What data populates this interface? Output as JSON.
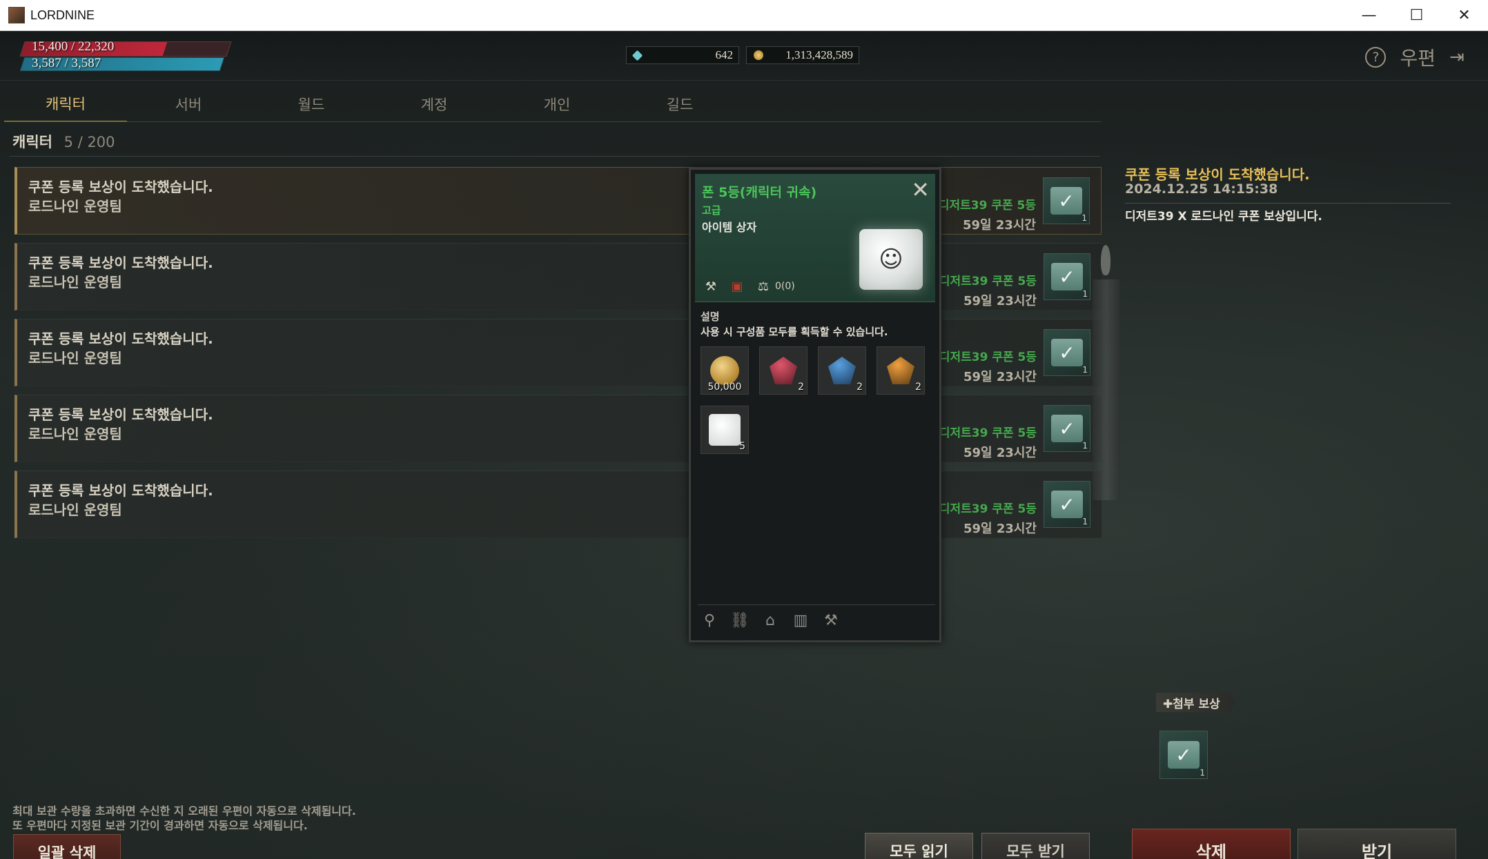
{
  "window": {
    "title": "LORDNINE",
    "minimize": "—",
    "maximize": "☐",
    "close": "✕"
  },
  "status": {
    "hp_text": "15,400 / 22,320",
    "hp_fraction": 0.69,
    "mp_text": "3,587 / 3,587",
    "mp_fraction": 1.0,
    "diamonds": "642",
    "gold": "1,313,428,589"
  },
  "header": {
    "title": "우편",
    "help": "?",
    "exit": "⇥"
  },
  "tabs": [
    {
      "label": "캐릭터",
      "active": true
    },
    {
      "label": "서버"
    },
    {
      "label": "월드"
    },
    {
      "label": "계정"
    },
    {
      "label": "개인"
    },
    {
      "label": "길드"
    }
  ],
  "mailbox": {
    "count_label": "캐릭터",
    "count": "5 / 200",
    "items": [
      {
        "title": "쿠폰 등록 보상이 도착했습니다.",
        "sender": "로드나인 운영팀",
        "item_name": "디저트39 쿠폰 5등",
        "expire": "59일 23시간",
        "reward_count": "1"
      },
      {
        "title": "쿠폰 등록 보상이 도착했습니다.",
        "sender": "로드나인 운영팀",
        "item_name": "디저트39 쿠폰 5등",
        "expire": "59일 23시간",
        "reward_count": "1"
      },
      {
        "title": "쿠폰 등록 보상이 도착했습니다.",
        "sender": "로드나인 운영팀",
        "item_name": "디저트39 쿠폰 5등",
        "expire": "59일 23시간",
        "reward_count": "1"
      },
      {
        "title": "쿠폰 등록 보상이 도착했습니다.",
        "sender": "로드나인 운영팀",
        "item_name": "디저트39 쿠폰 5등",
        "expire": "59일 23시간",
        "reward_count": "1"
      },
      {
        "title": "쿠폰 등록 보상이 도착했습니다.",
        "sender": "로드나인 운영팀",
        "item_name": "디저트39 쿠폰 5등",
        "expire": "59일 23시간",
        "reward_count": "1"
      }
    ]
  },
  "tooltip": {
    "name": "폰 5등(캐릭터 귀속)",
    "grade": "고급",
    "type": "아이템 상자",
    "weight": "0(0)",
    "desc_label": "설명",
    "desc": "사용 시 구성품 모두를 획득할 수 있습니다.",
    "contents": [
      {
        "icon": "gold-coin-icon",
        "count": "50,000"
      },
      {
        "icon": "red-gem-icon",
        "count": "2",
        "color": "#7a2a35"
      },
      {
        "icon": "blue-gem-icon",
        "count": "2",
        "color": "#2a5a8a"
      },
      {
        "icon": "orange-gem-icon",
        "count": "2",
        "color": "#8a5a1a"
      },
      {
        "icon": "white-box-icon",
        "count": "5"
      }
    ]
  },
  "detail": {
    "title": "쿠폰 등록 보상이 도착했습니다.",
    "date": "2024.12.25 14:15:38",
    "body": "디저트39 X 로드나인 쿠폰 보상입니다.",
    "attach_label": "✚첨부 보상",
    "attach_count": "1"
  },
  "footer": {
    "notice_line1": "최대 보관 수량을 초과하면 수신한 지 오래된 우편이 자동으로 삭제됩니다.",
    "notice_line2": "또 우편마다 지정된 보관 기간이 경과하면 자동으로 삭제됩니다.",
    "bulk_delete": "일괄 삭제",
    "read_all": "모두 읽기",
    "receive_all": "모두 받기",
    "delete": "삭제",
    "receive": "받기"
  },
  "colors": {
    "accent_gold": "#e7bf58",
    "item_green": "#46a84e",
    "hp_red": "#c0273b",
    "mp_blue": "#2c9bb5"
  }
}
